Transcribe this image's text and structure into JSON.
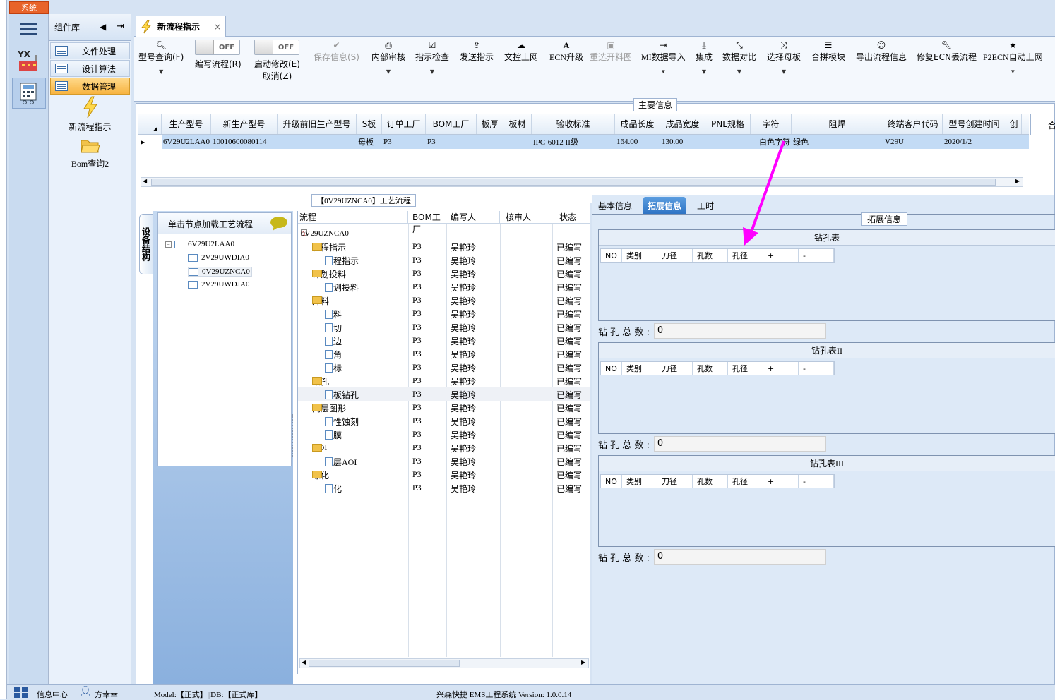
{
  "window": {
    "system_button": "系统"
  },
  "component_library": {
    "title": "组件库",
    "items": [
      {
        "label": "文件处理"
      },
      {
        "label": "设计算法"
      },
      {
        "label": "数据管理"
      }
    ],
    "big_items": [
      {
        "label": "新流程指示"
      },
      {
        "label": "Bom查询2"
      }
    ]
  },
  "tab": {
    "title": "新流程指示",
    "close": "×"
  },
  "toolbar": {
    "buttons": [
      {
        "label": "型号查询(F)",
        "icon": "search-icon"
      },
      {
        "label": "编写流程(R)",
        "toggle": "OFF"
      },
      {
        "label": "启动修改(E)",
        "sub": "取消(Z)",
        "toggle": "OFF"
      },
      {
        "label": "保存信息(S)",
        "icon": "check-icon",
        "disabled": true
      },
      {
        "label": "内部审核",
        "icon": "print-icon"
      },
      {
        "label": "指示检查",
        "icon": "checkbox-icon"
      },
      {
        "label": "发送指示",
        "icon": "upload-icon"
      },
      {
        "label": "文控上网",
        "icon": "cloud-upload-icon"
      },
      {
        "label": "ECN升级",
        "icon": "font-icon"
      },
      {
        "label": "重选开料图",
        "icon": "image-icon",
        "disabled": true
      },
      {
        "label": "MI数据导入",
        "icon": "sign-in-icon"
      },
      {
        "label": "集成",
        "icon": "download-icon"
      },
      {
        "label": "数据对比",
        "icon": "compress-icon"
      },
      {
        "label": "选择母板",
        "icon": "random-icon"
      },
      {
        "label": "合拼模块",
        "icon": "list-icon"
      },
      {
        "label": "导出流程信息",
        "icon": "smile-icon"
      },
      {
        "label": "修复ECN丢流程",
        "icon": "wrench-icon"
      },
      {
        "label": "P2ECN自动上网",
        "icon": "star-icon"
      }
    ]
  },
  "main_info": {
    "section_label": "主要信息",
    "columns": [
      "生产型号",
      "新生产型号",
      "升级前旧生产型号",
      "S板",
      "订单工厂",
      "BOM工厂",
      "板厚",
      "板材",
      "验收标准",
      "成品长度",
      "成品宽度",
      "PNL规格",
      "字符",
      "阻焊",
      "终端客户代码",
      "型号创建时间",
      "创"
    ],
    "row": [
      "6V29U2LAA0",
      "10010600080114",
      "",
      "母板",
      "P3",
      "P3",
      "",
      "",
      "IPC-6012 II级",
      "164.00",
      "130.00",
      "",
      "白色字符",
      "绿色",
      "V29U",
      "2020/1/2",
      ""
    ],
    "right_header_fragment": "合"
  },
  "process": {
    "section_label": "【0V29UZNCA0】工艺流程",
    "side_tab": "设备结构",
    "hint": "单击节点加载工艺流程",
    "nodes": [
      {
        "label": "6V29U2LAA0"
      },
      {
        "label": "2V29UWDIA0"
      },
      {
        "label": "0V29UZNCA0"
      },
      {
        "label": "2V29UWDJA0"
      }
    ],
    "tree_columns": [
      "流程",
      "BOM工厂",
      "编写人",
      "核审人",
      "状态"
    ],
    "root": "0V29UZNCA0",
    "rows": [
      {
        "name": "流程指示",
        "level": 1,
        "folder": true,
        "factory": "P3",
        "writer": "吴艳玲",
        "status": "已编写"
      },
      {
        "name": "流程指示",
        "level": 2,
        "folder": false,
        "factory": "P3",
        "writer": "吴艳玲",
        "status": "已编写"
      },
      {
        "name": "计划投料",
        "level": 1,
        "folder": true,
        "factory": "P3",
        "writer": "吴艳玲",
        "status": "已编写"
      },
      {
        "name": "计划投料",
        "level": 2,
        "folder": false,
        "factory": "P3",
        "writer": "吴艳玲",
        "status": "已编写"
      },
      {
        "name": "开料",
        "level": 1,
        "folder": true,
        "factory": "P3",
        "writer": "吴艳玲",
        "status": "已编写"
      },
      {
        "name": "开料",
        "level": 2,
        "folder": false,
        "factory": "P3",
        "writer": "吴艳玲",
        "status": "已编写"
      },
      {
        "name": "裁切",
        "level": 2,
        "folder": false,
        "factory": "P3",
        "writer": "吴艳玲",
        "status": "已编写"
      },
      {
        "name": "磨边",
        "level": 2,
        "folder": false,
        "factory": "P3",
        "writer": "吴艳玲",
        "status": "已编写"
      },
      {
        "name": "圆角",
        "level": 2,
        "folder": false,
        "factory": "P3",
        "writer": "吴艳玲",
        "status": "已编写"
      },
      {
        "name": "打标",
        "level": 2,
        "folder": false,
        "factory": "P3",
        "writer": "吴艳玲",
        "status": "已编写"
      },
      {
        "name": "钻孔",
        "level": 1,
        "folder": true,
        "factory": "P3",
        "writer": "吴艳玲",
        "status": "已编写"
      },
      {
        "name": "芯板钻孔",
        "level": 2,
        "folder": false,
        "factory": "P3",
        "writer": "吴艳玲",
        "status": "已编写",
        "selected": true
      },
      {
        "name": "内层图形",
        "level": 1,
        "folder": true,
        "factory": "P3",
        "writer": "吴艳玲",
        "status": "已编写"
      },
      {
        "name": "酸性蚀刻",
        "level": 2,
        "folder": false,
        "factory": "P3",
        "writer": "吴艳玲",
        "status": "已编写"
      },
      {
        "name": "退膜",
        "level": 2,
        "folder": false,
        "factory": "P3",
        "writer": "吴艳玲",
        "status": "已编写"
      },
      {
        "name": "AOI",
        "level": 1,
        "folder": true,
        "factory": "P3",
        "writer": "吴艳玲",
        "status": "已编写"
      },
      {
        "name": "内层AOI",
        "level": 2,
        "folder": false,
        "factory": "P3",
        "writer": "吴艳玲",
        "status": "已编写"
      },
      {
        "name": "棕化",
        "level": 1,
        "folder": true,
        "factory": "P3",
        "writer": "吴艳玲",
        "status": "已编写"
      },
      {
        "name": "棕化",
        "level": 2,
        "folder": false,
        "factory": "P3",
        "writer": "吴艳玲",
        "status": "已编写"
      }
    ]
  },
  "right": {
    "tabs": [
      "基本信息",
      "拓展信息",
      "工时"
    ],
    "section_label": "拓展信息",
    "drill_columns": [
      "NO",
      "类别",
      "刀径",
      "孔数",
      "孔径",
      "+",
      "-"
    ],
    "total_label": "钻 孔 总 数 :",
    "tables": [
      {
        "title": "钻孔表",
        "total": "0"
      },
      {
        "title": "钻孔表II",
        "total": "0"
      },
      {
        "title": "钻孔表III",
        "total": "0"
      }
    ]
  },
  "statusbar": {
    "info_center": "信息中心",
    "user": "方幸幸",
    "model": "Model:【正式】||DB:【正式库】",
    "app": "兴森快捷  EMS工程系统  Version: 1.0.0.14"
  },
  "colors": {
    "accent": "#2f74c4",
    "active_nav": "#f7b441",
    "selected_row": "#c3dbf5",
    "arrow": "#ff00ff"
  }
}
